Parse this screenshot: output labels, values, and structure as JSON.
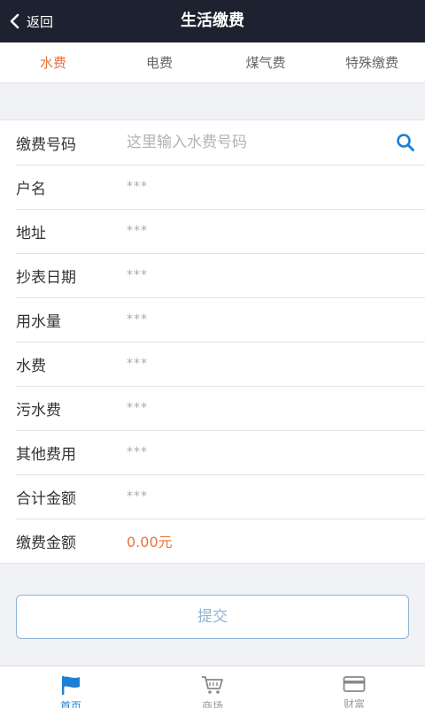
{
  "header": {
    "back_label": "返回",
    "title": "生活缴费"
  },
  "tabs": [
    {
      "label": "水费",
      "active": true
    },
    {
      "label": "电费",
      "active": false
    },
    {
      "label": "煤气费",
      "active": false
    },
    {
      "label": "特殊缴费",
      "active": false
    }
  ],
  "form": {
    "account": {
      "label": "缴费号码",
      "placeholder": "这里输入水费号码",
      "value": ""
    },
    "rows": [
      {
        "label": "户名",
        "value": "***"
      },
      {
        "label": "地址",
        "value": "***"
      },
      {
        "label": "抄表日期",
        "value": "***"
      },
      {
        "label": "用水量",
        "value": "***"
      },
      {
        "label": "水费",
        "value": "***"
      },
      {
        "label": "污水费",
        "value": "***"
      },
      {
        "label": "其他费用",
        "value": "***"
      },
      {
        "label": "合计金额",
        "value": "***"
      }
    ],
    "payment": {
      "label": "缴费金额",
      "value": "0.00元"
    }
  },
  "submit_label": "提交",
  "nav": [
    {
      "label": "首页",
      "icon": "flag-icon",
      "active": true
    },
    {
      "label": "商场",
      "icon": "cart-icon",
      "active": false
    },
    {
      "label": "财富",
      "icon": "card-icon",
      "active": false
    }
  ],
  "colors": {
    "header_bg": "#1e2230",
    "accent": "#e8743b",
    "primary": "#1e7fd6",
    "submit_border": "#8fb4d6"
  }
}
